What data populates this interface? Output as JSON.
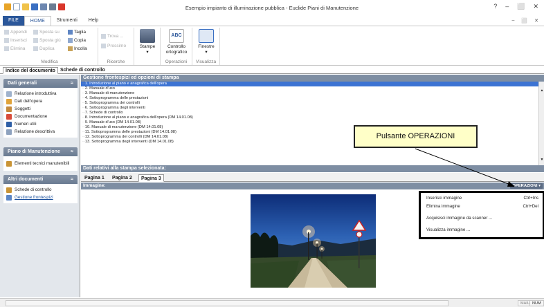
{
  "window": {
    "title": "Esempio impianto di illuminazione pubblica - Euclide Piani di Manutenzione",
    "controls": [
      "?",
      "–",
      "⬜",
      "✕"
    ],
    "inner_controls": [
      "–",
      "⬜",
      "✕"
    ]
  },
  "ribbon": {
    "tabs": [
      "FILE",
      "HOME",
      "Strumenti",
      "Help"
    ],
    "modifica": {
      "label": "Modifica",
      "appendi": "Appendi",
      "inserisci": "Inserisci",
      "elimina": "Elimina",
      "sposta_su": "Sposta su",
      "sposta_giu": "Sposta giù",
      "duplica": "Duplica",
      "taglia": "Taglia",
      "copia": "Copia",
      "incolla": "Incolla"
    },
    "ricerche": {
      "label": "Ricerche",
      "trova": "Trova ...",
      "prossimo": "Prossimo"
    },
    "stampe": {
      "label": "Stampe"
    },
    "operazioni": {
      "label": "Operazioni",
      "controllo_l1": "Controllo",
      "controllo_l2": "ortografico"
    },
    "visualizza": {
      "label": "Visualizza",
      "finestre": "Finestre"
    }
  },
  "doc_tabs": [
    "Indice del documento",
    "Schede di controllo"
  ],
  "left": {
    "dati_generali": {
      "title": "Dati generali",
      "items": [
        "Relazione introduttiva",
        "Dati dell'opera",
        "Soggetti",
        "Documentazione",
        "Numeri utili",
        "Relazione descrittiva"
      ]
    },
    "piano": {
      "title": "Piano di Manutenzione",
      "items": [
        "Elementi tecnici manutenibili"
      ]
    },
    "altri": {
      "title": "Altri documenti",
      "items": [
        "Schede di controllo",
        "Gestione frontespizi"
      ]
    }
  },
  "main": {
    "header": "Gestione frontespizi ed opzioni di stampa",
    "list": [
      "1. Introduzione al piano e anagrafica dell'opera",
      "2. Manuale d'uso",
      "3. Manuale di manutenzione",
      "4. Sottoprogramma delle prestazioni",
      "5. Sottoprogramma dei controlli",
      "6. Sottoprogramma degli interventi",
      "7. Schede di controllo",
      "8. Introduzione al piano e anagrafica dell'opera (DM 14.01.08)",
      "9. Manuale d'uso (DM 14.01.08)",
      "10. Manuale di manutenzione (DM 14.01.08)",
      "11. Sottoprogramma delle prestazioni (DM 14.01.08)",
      "12. Sottoprogramma dei controlli (DM 14.01.08)",
      "13. Sottoprogramma degli interventi (DM 14.01.08)"
    ],
    "selected_header": "Dati relativi alla stampa selezionata:",
    "page_tabs": [
      "Pagina 1",
      "Pagina 2",
      "Pagina 3"
    ],
    "image_label": "Immagine:",
    "operazioni_button": "OPERAZIONI ▾",
    "menu": [
      {
        "label": "Inserisci immagine",
        "shortcut": "Ctrl+Ins"
      },
      {
        "label": "Elimina immagine",
        "shortcut": "Ctrl+Del"
      },
      {
        "label": "Acquisisci immagine da scanner ...",
        "shortcut": ""
      },
      {
        "label": "Visualizza immagine ...",
        "shortcut": ""
      }
    ]
  },
  "callout": "Pulsante OPERAZIONI",
  "status": {
    "maiu": "MAIU",
    "num": "NUM"
  },
  "colors": {
    "accent": "#2b579a",
    "panel_header": "#7e8ea3",
    "selection": "#3c73d3",
    "callout_bg": "#ffffc8"
  }
}
